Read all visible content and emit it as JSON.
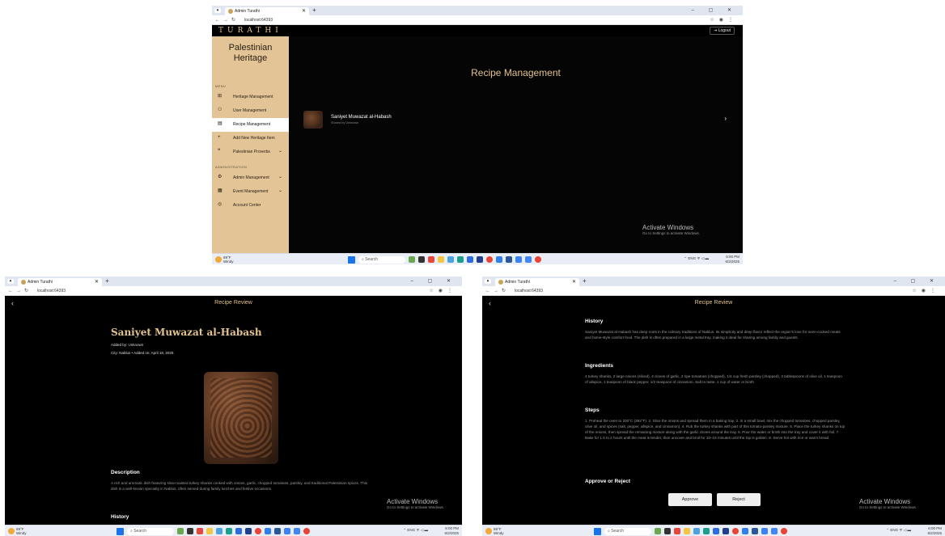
{
  "browser": {
    "tab_title": "Admin Turathi",
    "new_tab": "+",
    "url": "localhost:64393",
    "window_controls": "–  ▢  ✕"
  },
  "taskbar": {
    "weather_temp": "69°F",
    "weather_desc": "Windy",
    "search": "Search",
    "lang": "ENG",
    "time": "6:00 PM",
    "date": "6/2/2025"
  },
  "activate": {
    "title": "Activate Windows",
    "subtitle": "Go to Settings to activate Windows."
  },
  "admin": {
    "brand": "TURATHI",
    "logout": "Logout",
    "sidebar_title": "Palestinian Heritage",
    "menu_label": "MENU",
    "admin_label": "ADMINISTRATION",
    "items": [
      {
        "label": "Heritage Management",
        "icon": "grid-icon"
      },
      {
        "label": "User Management",
        "icon": "users-icon"
      },
      {
        "label": "Recipe Management",
        "icon": "book-icon"
      },
      {
        "label": "Add New Heritage Item",
        "icon": "plus-icon"
      },
      {
        "label": "Palestinian Proverbs",
        "icon": "quote-icon"
      }
    ],
    "admin_items": [
      {
        "label": "Admin Management",
        "icon": "admin-icon"
      },
      {
        "label": "Event Management",
        "icon": "calendar-icon"
      },
      {
        "label": "Account Center",
        "icon": "account-icon"
      }
    ],
    "page_title": "Recipe Management",
    "recipe": {
      "name": "Saniyet Muwazat al-Habash",
      "shared_by": "Shared by Unknown"
    }
  },
  "review": {
    "header_title": "Recipe Review",
    "dish_name": "Saniyet Muwazat al-Habash",
    "added_by": "Added by: Unknown",
    "city_line": "City: Nablus  •  Added on: April 18, 2025",
    "description_heading": "Description",
    "description": "A rich and aromatic dish featuring slow-roasted turkey shanks cooked with onions, garlic, chopped tomatoes, parsley, and traditional Palestinian spices. This dish is a well-known specialty in Nablus, often served during family lunches and festive occasions.",
    "history_heading": "History",
    "history": "Saniyet Muwazat al-Habash has deep roots in the culinary traditions of Nablus. Its simplicity and deep flavor reflect the region's love for oven-cooked meats and home-style comfort food. The dish is often prepared in a large metal tray, making it ideal for sharing among family and guests.",
    "ingredients_heading": "Ingredients",
    "ingredients": "4 turkey shanks, 2 large onions (sliced), 4 cloves of garlic, 2 ripe tomatoes (chopped), 1/4 cup fresh parsley (chopped), 3 tablespoons of olive oil, 1 teaspoon of allspice, 1 teaspoon of black pepper, 1/2 teaspoon of cinnamon, Salt to taste, 1 cup of water or broth",
    "steps_heading": "Steps",
    "steps": "1. Preheat the oven to 200°C (392°F). 2. Slice the onions and spread them in a baking tray. 3. In a small bowl, mix the chopped tomatoes, chopped parsley, olive oil, and spices (salt, pepper, allspice, and cinnamon). 4. Rub the turkey shanks with part of this tomato-parsley mixture. 5. Place the turkey shanks on top of the onions, then spread the remaining mixture along with the garlic cloves around the tray. 6. Pour the water or broth into the tray and cover it with foil. 7. Bake for 1.5 to 2 hours until the meat is tender, then uncover and broil for 10–15 minutes until the top is golden. 8. Serve hot with rice or warm bread.",
    "approve_heading": "Approve or Reject",
    "approve": "Approve",
    "reject": "Reject"
  }
}
